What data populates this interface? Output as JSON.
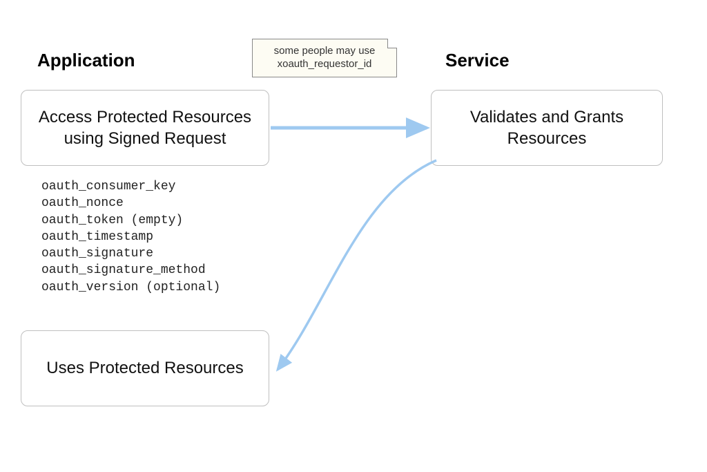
{
  "headings": {
    "left": "Application",
    "right": "Service"
  },
  "note": {
    "line1": "some people may use",
    "line2": "xoauth_requestor_id"
  },
  "nodes": {
    "access": "Access Protected Resources using Signed Request",
    "validate": "Validates and Grants Resources",
    "uses": "Uses Protected Resources"
  },
  "params": [
    "oauth_consumer_key",
    "oauth_nonce",
    "oauth_token (empty)",
    "oauth_timestamp",
    "oauth_signature",
    "oauth_signature_method",
    "oauth_version (optional)"
  ],
  "colors": {
    "arrow": "#9ec9f0",
    "arrow_stroke": "#a8d0f2"
  }
}
